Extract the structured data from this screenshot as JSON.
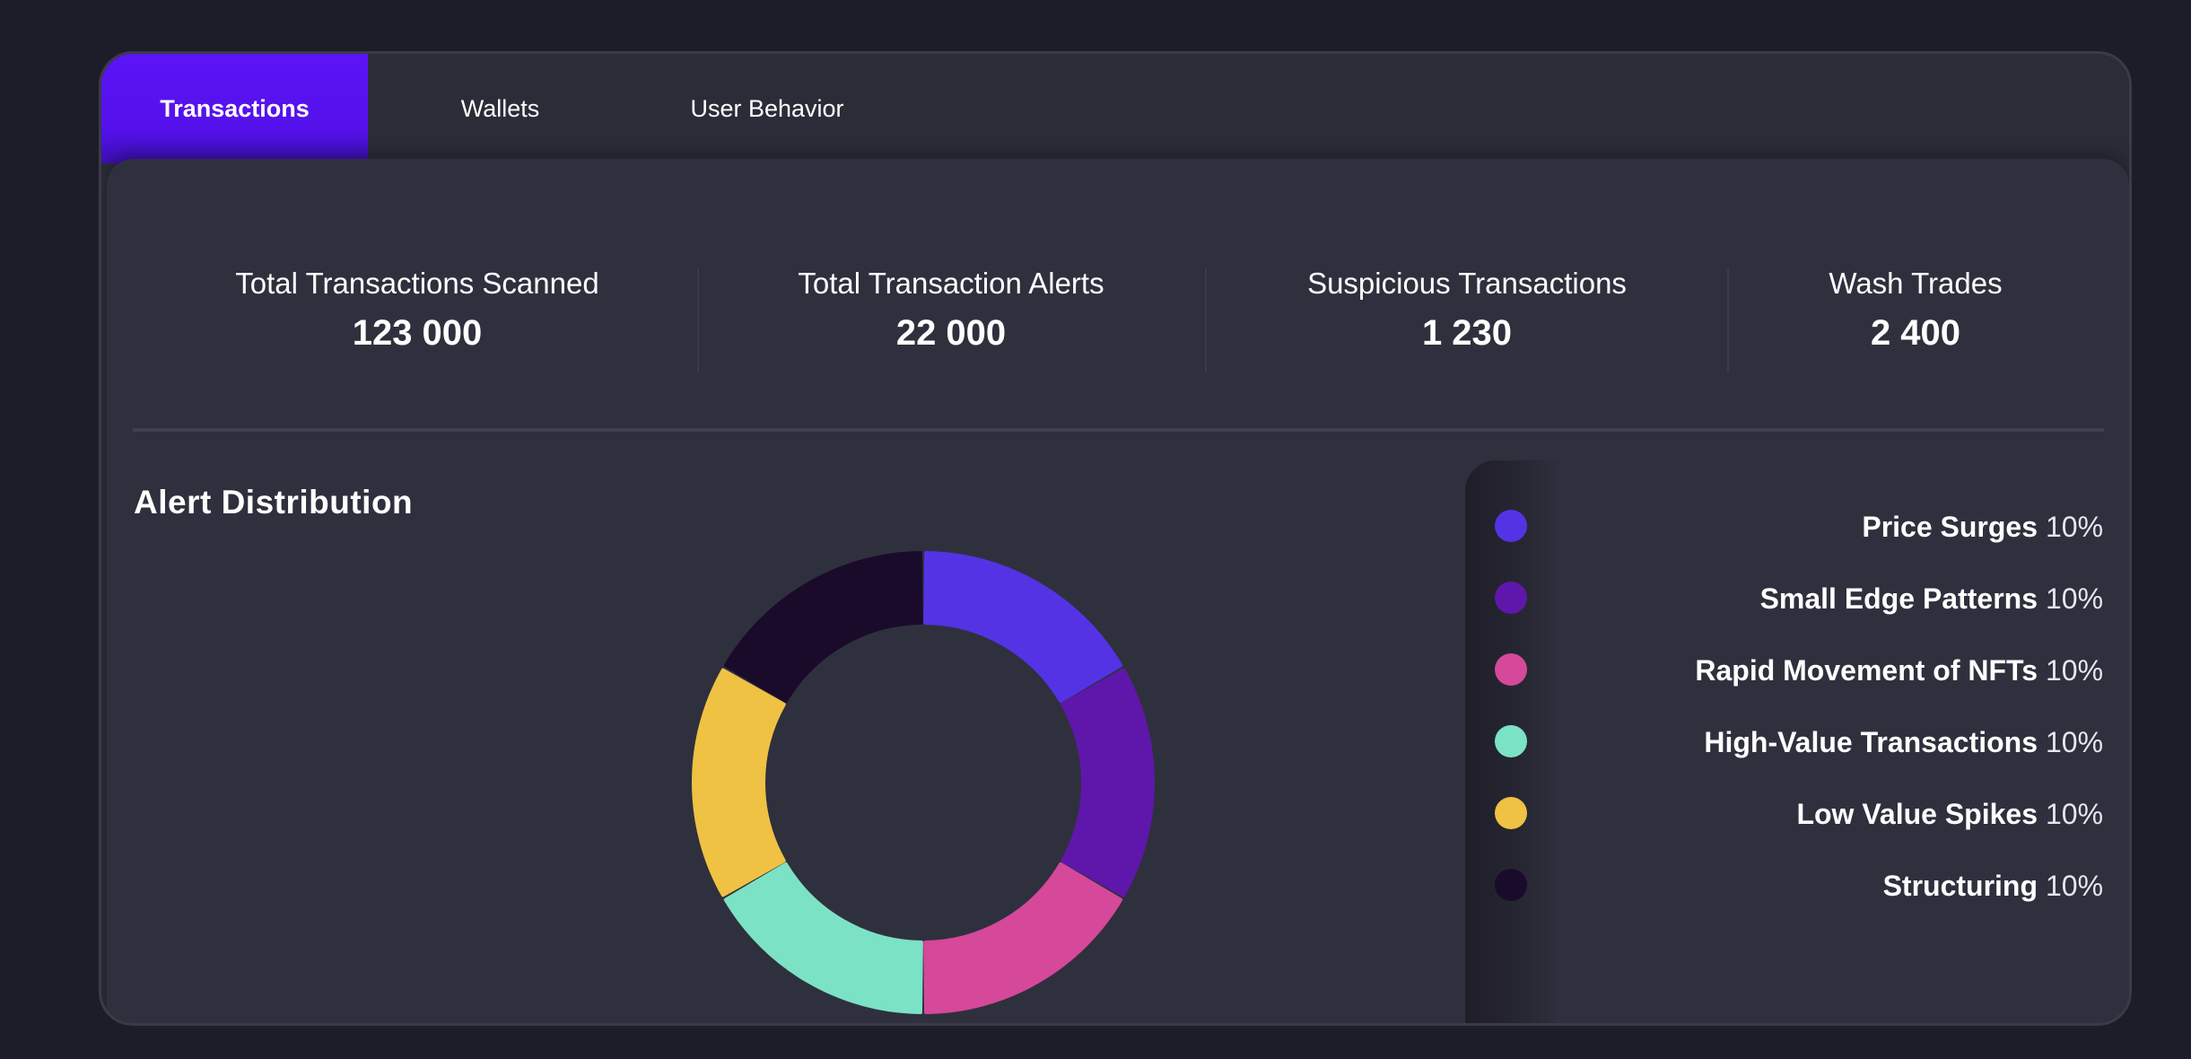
{
  "tabs": [
    {
      "label": "Transactions",
      "active": true
    },
    {
      "label": "Wallets",
      "active": false
    },
    {
      "label": "User Behavior",
      "active": false
    }
  ],
  "stats": [
    {
      "label": "Total Transactions Scanned",
      "value": "123 000"
    },
    {
      "label": "Total Transaction Alerts",
      "value": "22 000"
    },
    {
      "label": "Suspicious Transactions",
      "value": "1 230"
    },
    {
      "label": "Wash Trades",
      "value": "2 400"
    }
  ],
  "alert_distribution": {
    "title": "Alert Distribution",
    "items": [
      {
        "label": "Price Surges",
        "value": "10%",
        "color": "#5433e5"
      },
      {
        "label": "Small Edge Patterns",
        "value": "10%",
        "color": "#5f17ab"
      },
      {
        "label": "Rapid Movement of NFTs",
        "value": "10%",
        "color": "#d5489a"
      },
      {
        "label": "High-Value Transactions",
        "value": "10%",
        "color": "#7ce2c5"
      },
      {
        "label": "Low Value Spikes",
        "value": "10%",
        "color": "#efc243"
      },
      {
        "label": "Structuring",
        "value": "10%",
        "color": "#1a0b2b"
      }
    ]
  },
  "colors": {
    "accent": "#5b14f7",
    "background": "#1d1c29",
    "card": "#2b2c38",
    "panel": "#2f303d"
  }
}
